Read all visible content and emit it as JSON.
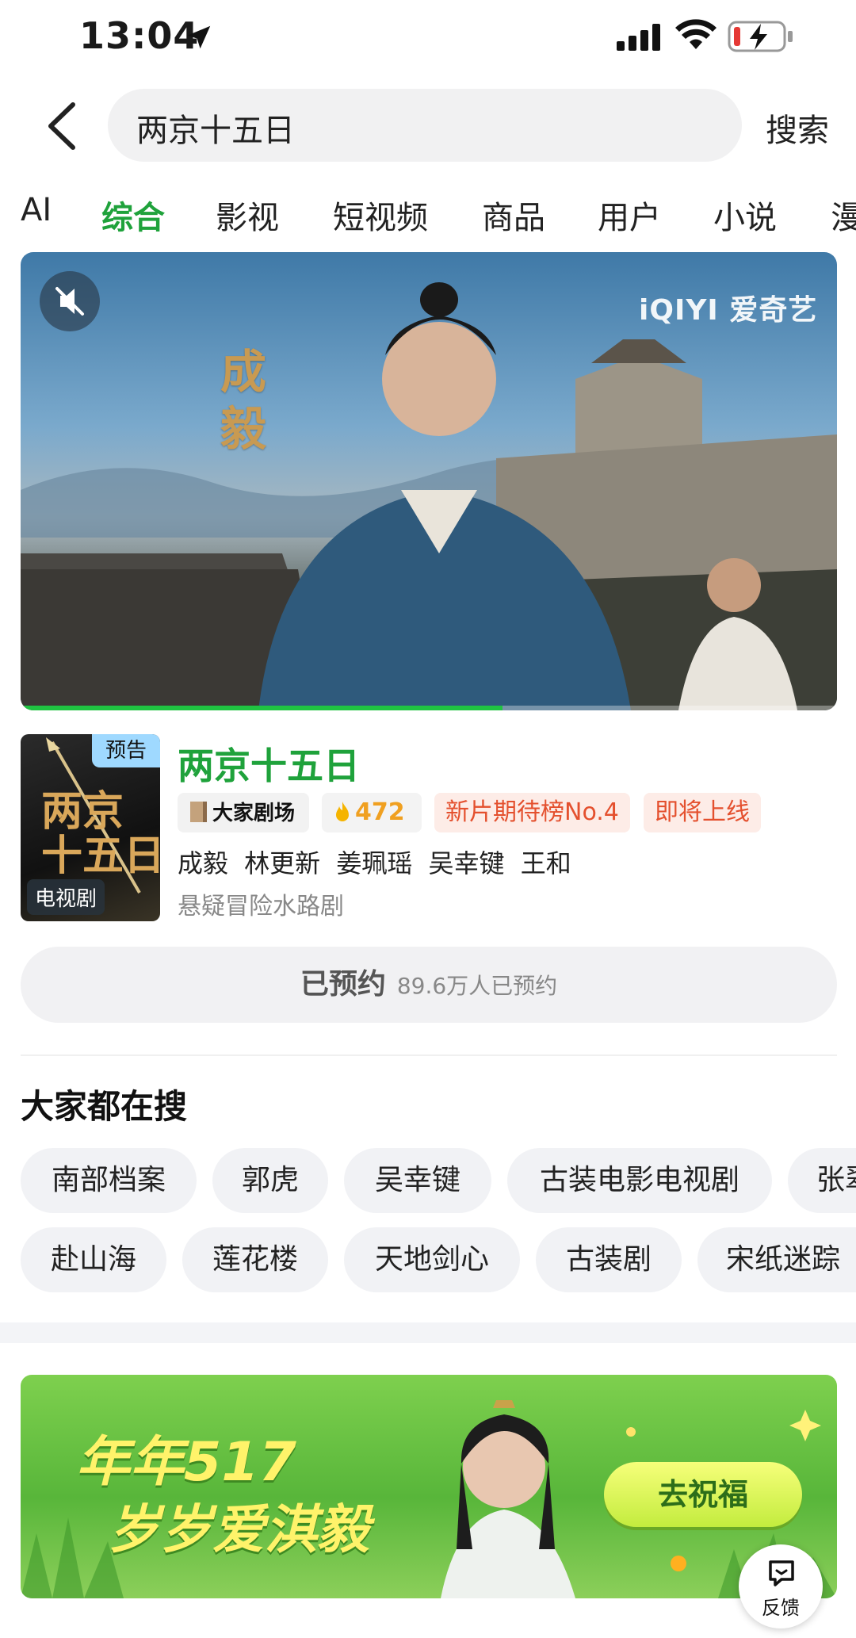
{
  "status_bar": {
    "time": "13:04"
  },
  "search": {
    "query": "两京十五日",
    "submit_label": "搜索"
  },
  "tabs": [
    {
      "label": "AI"
    },
    {
      "label": "综合",
      "active": true
    },
    {
      "label": "影视"
    },
    {
      "label": "短视频"
    },
    {
      "label": "商品"
    },
    {
      "label": "用户"
    },
    {
      "label": "小说"
    },
    {
      "label": "漫"
    }
  ],
  "video": {
    "brand": "iQIYI 爱奇艺",
    "calligraphy": "成毅",
    "progress": 0.59
  },
  "show": {
    "poster_badge": "预告",
    "poster_calligraphy": "两京\n十五日",
    "poster_type": "电视剧",
    "title": "两京十五日",
    "channel_tag": "大家剧场",
    "heat": "472",
    "rank_tag": "新片期待榜No.4",
    "status_tag": "即将上线",
    "cast": "成毅 林更新 姜珮瑶 吴幸键 王和",
    "genre": "悬疑冒险水路剧"
  },
  "reserve": {
    "label": "已预约",
    "count": "89.6万人已预约"
  },
  "trending": {
    "title": "大家都在搜",
    "row1": [
      "南部档案",
      "郭虎",
      "吴幸键",
      "古装电影电视剧",
      "张翠"
    ],
    "row2": [
      "赴山海",
      "莲花楼",
      "天地剑心",
      "古装剧",
      "宋纸迷踪"
    ]
  },
  "promo": {
    "line1": "年年517",
    "line2": "岁岁爱淇毅",
    "cta": "去祝福"
  },
  "feedback": {
    "label": "反馈"
  },
  "colors": {
    "accent": "#1fa23b",
    "tag_red": "#e4502e",
    "heat": "#f0a020"
  }
}
